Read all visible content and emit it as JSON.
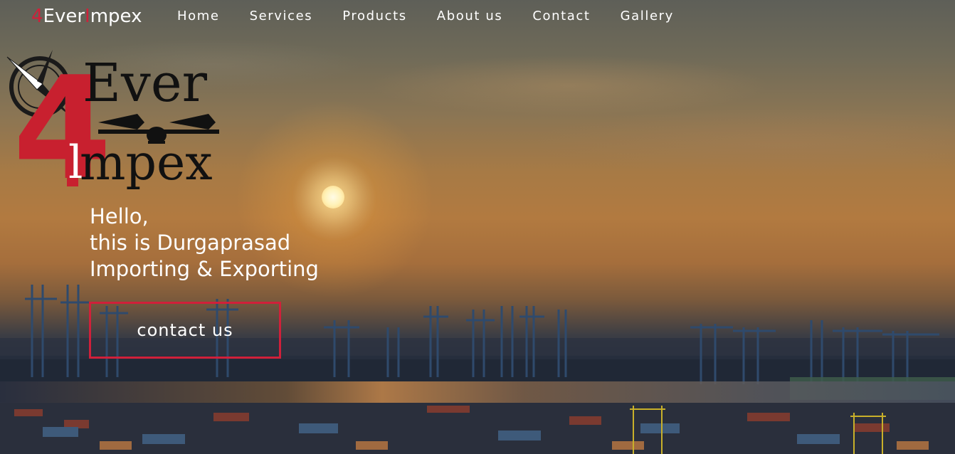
{
  "brand": {
    "digit": "4",
    "part1": "Ever",
    "accent": "I",
    "part2": "mpex"
  },
  "nav": {
    "items": [
      {
        "label": "Home"
      },
      {
        "label": "Services"
      },
      {
        "label": "Products"
      },
      {
        "label": "About us"
      },
      {
        "label": "Contact"
      },
      {
        "label": "Gallery"
      }
    ]
  },
  "logo": {
    "digit": "4",
    "word1": "Ever",
    "accent": "l",
    "word2": "mpex"
  },
  "hero": {
    "line1": "Hello,",
    "line2": "this is Durgaprasad",
    "line3": "Importing & Exporting",
    "cta_label": "contact us"
  },
  "colors": {
    "accent": "#d0203a",
    "text": "#ffffff"
  }
}
